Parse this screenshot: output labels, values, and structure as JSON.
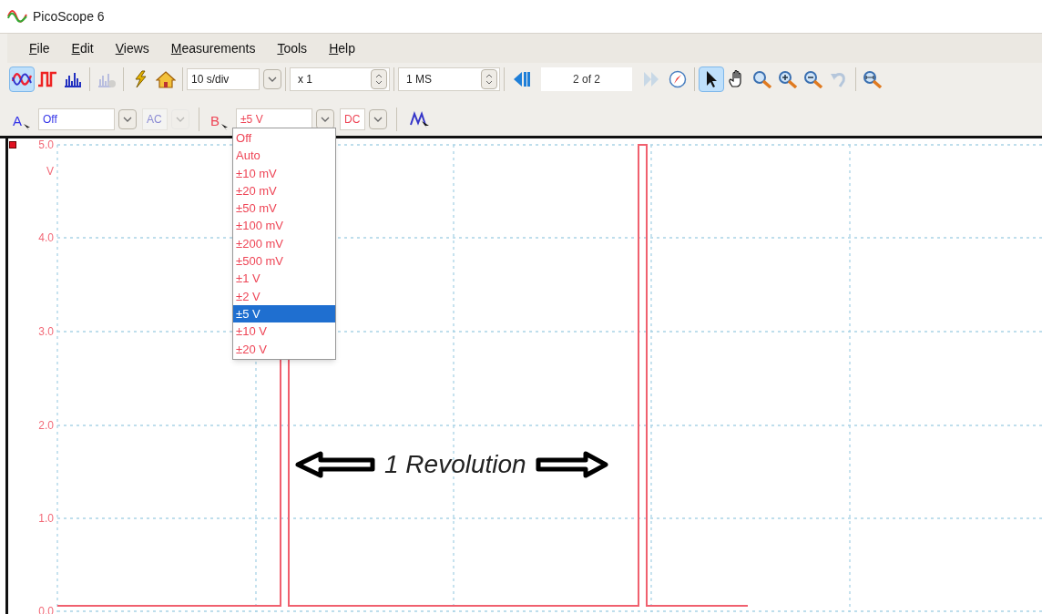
{
  "window": {
    "title": "PicoScope 6"
  },
  "menu": [
    {
      "label": "File"
    },
    {
      "label": "Edit"
    },
    {
      "label": "Views"
    },
    {
      "label": "Measurements"
    },
    {
      "label": "Tools"
    },
    {
      "label": "Help"
    }
  ],
  "toolbar": {
    "views": [
      {
        "kind": "scope",
        "selected": true,
        "disabled": false
      },
      {
        "kind": "persistence",
        "selected": false,
        "disabled": false
      },
      {
        "kind": "spectrum",
        "selected": false,
        "disabled": false
      },
      {
        "kind": "spectrum-hand",
        "selected": false,
        "disabled": true
      }
    ],
    "actions": [
      {
        "kind": "wand",
        "disabled": false
      },
      {
        "kind": "home",
        "disabled": false
      }
    ],
    "timebase": "10 s/div",
    "zoom_factor": "x 1",
    "samples": "1 MS",
    "buffer": "2 of 2",
    "nav": [
      {
        "kind": "back",
        "disabled": false
      },
      {
        "kind": "forward",
        "disabled": true
      },
      {
        "kind": "compass",
        "disabled": false
      }
    ],
    "tools": [
      {
        "kind": "pointer",
        "selected": true,
        "disabled": false
      },
      {
        "kind": "hand",
        "selected": false,
        "disabled": false
      },
      {
        "kind": "zoom",
        "selected": false,
        "disabled": false
      },
      {
        "kind": "zoom-in",
        "selected": false,
        "disabled": false
      },
      {
        "kind": "zoom-out",
        "selected": false,
        "disabled": false
      },
      {
        "kind": "undo",
        "selected": false,
        "disabled": true
      },
      {
        "kind": "zoom-fit",
        "selected": false,
        "disabled": false
      }
    ]
  },
  "channels": [
    {
      "name": "A",
      "color": "#3535e8",
      "range": "Off",
      "coupling": "AC",
      "coupling_disabled": true,
      "open": false
    },
    {
      "name": "B",
      "color": "#ee4455",
      "range": "±5 V",
      "coupling": "DC",
      "coupling_disabled": false,
      "open": true
    }
  ],
  "range_options": [
    {
      "label": "Off",
      "selected": false
    },
    {
      "label": "Auto",
      "selected": false
    },
    {
      "label": "±10 mV",
      "selected": false
    },
    {
      "label": "±20 mV",
      "selected": false
    },
    {
      "label": "±50 mV",
      "selected": false
    },
    {
      "label": "±100 mV",
      "selected": false
    },
    {
      "label": "±200 mV",
      "selected": false
    },
    {
      "label": "±500 mV",
      "selected": false
    },
    {
      "label": "±1 V",
      "selected": false
    },
    {
      "label": "±2 V",
      "selected": false
    },
    {
      "label": "±5 V",
      "selected": true
    },
    {
      "label": "±10 V",
      "selected": false
    },
    {
      "label": "±20 V",
      "selected": false
    }
  ],
  "scope": {
    "y_labels": [
      "5.0",
      "4.0",
      "3.0",
      "2.0",
      "1.0",
      "0.0"
    ],
    "unit": "V",
    "annotation": "1 Revolution"
  }
}
